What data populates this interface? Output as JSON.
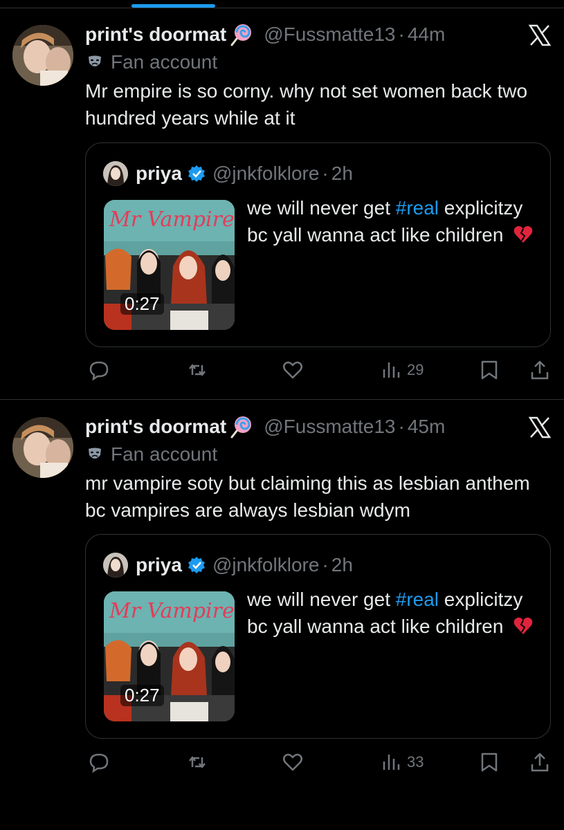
{
  "tweets": [
    {
      "display_name": "print's doormat",
      "handle": "@Fussmatte13",
      "separator": "·",
      "time": "44m",
      "label": "Fan account",
      "text": "Mr empire is so corny. why not set women back two hundred years while at it",
      "quote": {
        "name": "priya",
        "handle": "@jnkfolklore",
        "separator": "·",
        "time": "2h",
        "text_before": "we will never get ",
        "hashtag": "#real",
        "text_after": " explicitzy bc yall wanna act like children",
        "emoji": "broken-heart",
        "media_title": "Mr Vampire",
        "duration": "0:27"
      },
      "views": "29"
    },
    {
      "display_name": "print's doormat",
      "handle": "@Fussmatte13",
      "separator": "·",
      "time": "45m",
      "label": "Fan account",
      "text": "mr vampire soty but claiming this as lesbian anthem bc vampires are always lesbian wdym",
      "quote": {
        "name": "priya",
        "handle": "@jnkfolklore",
        "separator": "·",
        "time": "2h",
        "text_before": "we will never get ",
        "hashtag": "#real",
        "text_after": " explicitzy bc yall wanna act like children",
        "emoji": "broken-heart",
        "media_title": "Mr Vampire",
        "duration": "0:27"
      },
      "views": "33"
    }
  ],
  "icons": {
    "reply": "reply-icon",
    "repost": "repost-icon",
    "like": "like-icon",
    "views": "views-icon",
    "bookmark": "bookmark-icon",
    "share": "share-icon",
    "platform": "x-logo-icon",
    "label": "theater-mask-icon",
    "verified": "verified-badge-icon"
  },
  "colors": {
    "background": "#000000",
    "text": "#e7e9ea",
    "muted": "#71767b",
    "accent": "#1d9bf0",
    "border": "#2f3336"
  }
}
